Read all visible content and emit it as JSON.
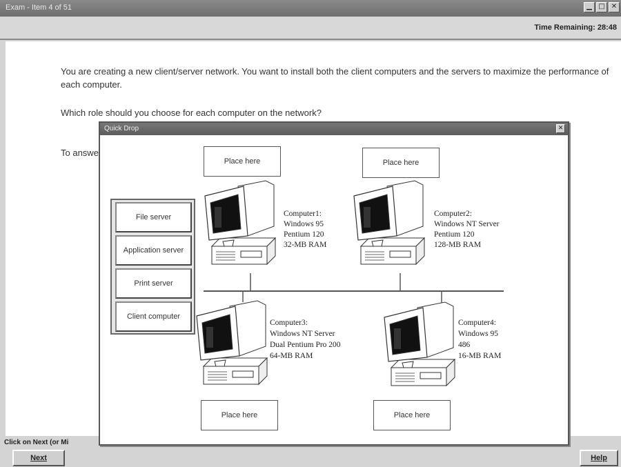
{
  "window": {
    "title": "Exam - Item 4 of 51",
    "buttons": {
      "minimize": "▁",
      "maximize": "□",
      "close": "✕"
    }
  },
  "header": {
    "time_remaining": "Time Remaining: 28:48"
  },
  "question": {
    "line1": "You are creating a new client/server network. You want to install both the client computers and the servers to maximize the performance of each computer.",
    "line2": "Which role should you choose for each computer on the network?",
    "line3": "To answer"
  },
  "dialog": {
    "title": "Quick Drop",
    "close": "✕"
  },
  "palette": {
    "items": [
      {
        "label": "File server"
      },
      {
        "label": "Application server"
      },
      {
        "label": "Print server"
      },
      {
        "label": "Client computer"
      }
    ]
  },
  "targets": [
    {
      "label": "Place here"
    },
    {
      "label": "Place here"
    },
    {
      "label": "Place here"
    },
    {
      "label": "Place here"
    }
  ],
  "computers": [
    {
      "name": "Computer1:",
      "os": "Windows 95",
      "cpu": "Pentium 120",
      "ram": "32-MB RAM"
    },
    {
      "name": "Computer2:",
      "os": "Windows NT Server",
      "cpu": "Pentium 120",
      "ram": "128-MB RAM"
    },
    {
      "name": "Computer3:",
      "os": "Windows NT Server",
      "cpu": "Dual Pentium Pro 200",
      "ram": "64-MB RAM"
    },
    {
      "name": "Computer4:",
      "os": "Windows 95",
      "cpu": "486",
      "ram": "16-MB RAM"
    }
  ],
  "footer": {
    "instruction": "Click on Next (or Mi",
    "next_label": "Next",
    "help_label": "Help"
  },
  "icons": [
    "computer-icon",
    "close-icon"
  ]
}
